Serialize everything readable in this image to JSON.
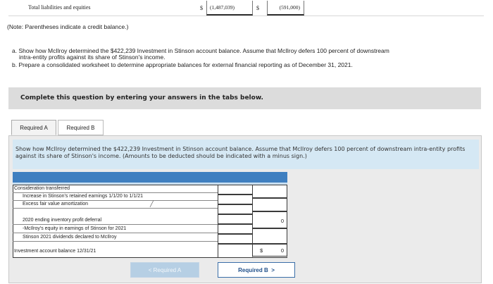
{
  "top": {
    "label": "Total liabilities and equities",
    "dollar1": "$",
    "value1": "(1,487,039)",
    "dollar2": "$",
    "value2": "(591,000)"
  },
  "note": "(Note: Parentheses indicate a credit balance.)",
  "tasks": {
    "a": "a. Show how McIlroy determined the $422,239 Investment in Stinson account balance. Assume that McIlroy defers 100 percent of downstream",
    "a_cont": "intra-entity profits against its share of Stinson's income.",
    "b": "b. Prepare a consolidated worksheet to determine appropriate balances for external financial reporting as of December 31, 2021."
  },
  "panel": {
    "title": "Complete this question by entering your answers in the tabs below."
  },
  "tabs": [
    {
      "label": "Required A"
    },
    {
      "label": "Required B"
    }
  ],
  "instructions": "Show how McIlroy determined the $422,239 Investment in Stinson account balance. Assume that McIlroy defers 100 percent of downstream intra-entity profits against its share of Stinson's income. (Amounts to be deducted should be indicated with a minus sign.)",
  "worksheet": {
    "rows": [
      {
        "label": "Consideration transferred",
        "value": ""
      },
      {
        "label": "Increase in Stinson's retained earnings 1/1/20 to 1/1/21",
        "value": ""
      },
      {
        "label": "Excess fair value amortization",
        "value": ""
      },
      {
        "label": "2020 ending inventory profit deferral",
        "value": "0"
      },
      {
        "label": "-McIlroy's equity in earnings of Stinson for 2021",
        "value": ""
      },
      {
        "label": "Stinson 2021 dividends declared to McIlroy",
        "value": ""
      },
      {
        "label": "Investment account balance 12/31/21",
        "dollar": "$",
        "value": "0"
      }
    ]
  },
  "nav": {
    "prev": "< Required A",
    "next": "Required B  >"
  }
}
